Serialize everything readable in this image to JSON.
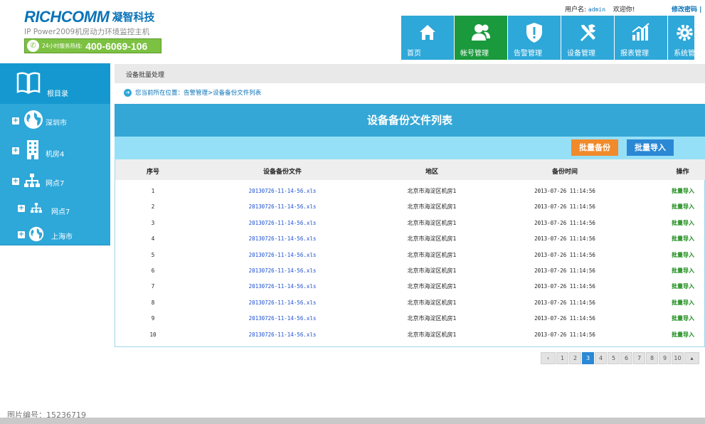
{
  "brand": {
    "name_en": "RICHCOMM",
    "name_cn": "凝智科技",
    "subtitle": "IP Power2009机房动力环境监控主机",
    "hotline_label": "24小时服务热线:",
    "hotline_number": "400-6069-106"
  },
  "userbar": {
    "user_label": "用户名:",
    "username": "admin",
    "welcome": "欢迎你!",
    "change_password": "修改密码 |"
  },
  "nav": [
    {
      "label": "首页",
      "icon": "home-icon"
    },
    {
      "label": "帐号管理",
      "icon": "users-icon",
      "active": true
    },
    {
      "label": "告警管理",
      "icon": "shield-alert-icon"
    },
    {
      "label": "设备管理",
      "icon": "tools-icon"
    },
    {
      "label": "报表管理",
      "icon": "chart-icon"
    },
    {
      "label": "系统管理",
      "icon": "gear-icon"
    }
  ],
  "sidebar": {
    "root": "根目录",
    "items": [
      {
        "label": "深圳市",
        "icon": "globe-icon"
      },
      {
        "label": "机房4",
        "icon": "building-icon"
      },
      {
        "label": "网点7",
        "icon": "network-icon"
      },
      {
        "label": "网点7",
        "icon": "network-icon"
      },
      {
        "label": "上海市",
        "icon": "globe-icon"
      }
    ]
  },
  "page": {
    "section_title": "设备批量处理",
    "location": "您当前所在位置：告警管理>设备备份文件列表",
    "panel_title": "设备备份文件列表",
    "btn_backup": "批量备份",
    "btn_import": "批量导入"
  },
  "table": {
    "headers": [
      "序号",
      "设备备份文件",
      "地区",
      "备份时间",
      "操作"
    ],
    "rows": [
      {
        "no": "1",
        "file": "20130726-11-14-56.xls",
        "region": "北京市海淀区机房1",
        "time": "2013-07-26 11:14:56",
        "op": "批量导入"
      },
      {
        "no": "2",
        "file": "20130726-11-14-56.xls",
        "region": "北京市海淀区机房1",
        "time": "2013-07-26 11:14:56",
        "op": "批量导入"
      },
      {
        "no": "3",
        "file": "20130726-11-14-56.xls",
        "region": "北京市海淀区机房1",
        "time": "2013-07-26 11:14:56",
        "op": "批量导入"
      },
      {
        "no": "4",
        "file": "20130726-11-14-56.xls",
        "region": "北京市海淀区机房1",
        "time": "2013-07-26 11:14:56",
        "op": "批量导入"
      },
      {
        "no": "5",
        "file": "20130726-11-14-56.xls",
        "region": "北京市海淀区机房1",
        "time": "2013-07-26 11:14:56",
        "op": "批量导入"
      },
      {
        "no": "6",
        "file": "20130726-11-14-56.xls",
        "region": "北京市海淀区机房1",
        "time": "2013-07-26 11:14:56",
        "op": "批量导入"
      },
      {
        "no": "7",
        "file": "20130726-11-14-56.xls",
        "region": "北京市海淀区机房1",
        "time": "2013-07-26 11:14:56",
        "op": "批量导入"
      },
      {
        "no": "8",
        "file": "20130726-11-14-56.xls",
        "region": "北京市海淀区机房1",
        "time": "2013-07-26 11:14:56",
        "op": "批量导入"
      },
      {
        "no": "9",
        "file": "20130726-11-14-56.xls",
        "region": "北京市海淀区机房1",
        "time": "2013-07-26 11:14:56",
        "op": "批量导入"
      },
      {
        "no": "10",
        "file": "20130726-11-14-56.xls",
        "region": "北京市海淀区机房1",
        "time": "2013-07-26 11:14:56",
        "op": "批量导入"
      }
    ]
  },
  "pager": {
    "prev": "‹",
    "pages": [
      "1",
      "2",
      "3",
      "4",
      "5",
      "6",
      "7",
      "8",
      "9",
      "10"
    ],
    "current": "3",
    "next": "▴"
  },
  "watermark": "图片编号：15236719",
  "colors": {
    "nav_blue": "#2ea7d9",
    "nav_active_green": "#1a9a3c",
    "orange_button": "#f08a2a",
    "blue_button": "#2a88d5",
    "op_green": "#1a8a1a"
  }
}
